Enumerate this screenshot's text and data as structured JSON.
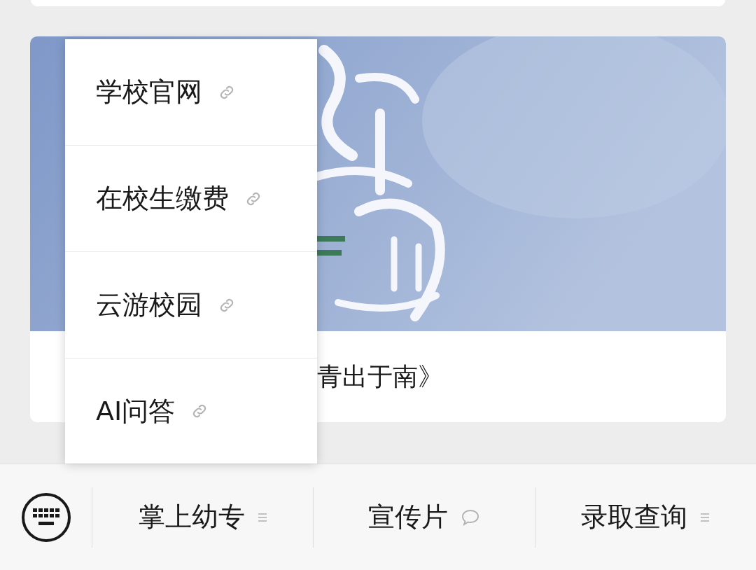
{
  "article_card": {
    "kind": "picture",
    "caption": "青出于南》"
  },
  "popup_menu": {
    "items": [
      {
        "label": "学校官网",
        "kind": "link"
      },
      {
        "label": "在校生缴费",
        "kind": "link"
      },
      {
        "label": "云游校园",
        "kind": "link"
      },
      {
        "label": "AI问答",
        "kind": "link"
      }
    ]
  },
  "bottom_bar": {
    "tabs": [
      {
        "label": "掌上幼专",
        "kind": "menu"
      },
      {
        "label": "宣传片",
        "kind": "message"
      },
      {
        "label": "录取查询",
        "kind": "menu"
      }
    ]
  }
}
